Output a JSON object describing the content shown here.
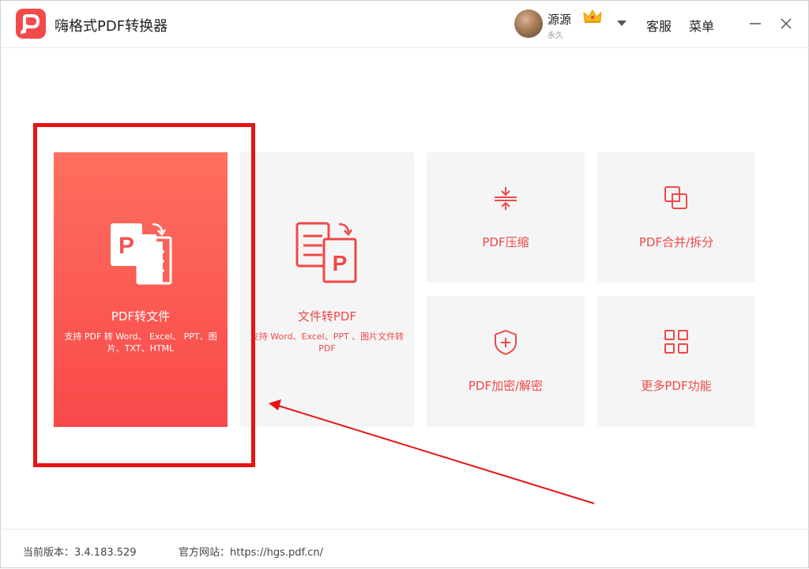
{
  "app": {
    "title": "嗨格式PDF转换器"
  },
  "header": {
    "username": "源源",
    "membership": "永久",
    "service": "客服",
    "menu": "菜单"
  },
  "cards": {
    "pdf_to_file": {
      "title": "PDF转文件",
      "desc": "支持 PDF 转 Word、 Excel、 PPT、图片、TXT、HTML"
    },
    "file_to_pdf": {
      "title": "文件转PDF",
      "desc": "支持 Word、Excel、PPT 、图片文件转 PDF"
    },
    "compress": {
      "title": "PDF压缩"
    },
    "merge_split": {
      "title": "PDF合并/拆分"
    },
    "encrypt_decrypt": {
      "title": "PDF加密/解密"
    },
    "more": {
      "title": "更多PDF功能"
    }
  },
  "footer": {
    "version": "当前版本：3.4.183.529",
    "website": "官方网站：https://hgs.pdf.cn/"
  },
  "colors": {
    "accent": "#f04848",
    "card_bg": "#f5f5f5",
    "annotation": "#e61414"
  },
  "icons": {
    "logo": "pdf-logo-icon",
    "crown": "crown-icon",
    "dropdown": "dropdown-arrow-icon",
    "compress": "compress-icon",
    "merge": "merge-icon",
    "encrypt": "shield-icon",
    "more": "grid-icon"
  }
}
